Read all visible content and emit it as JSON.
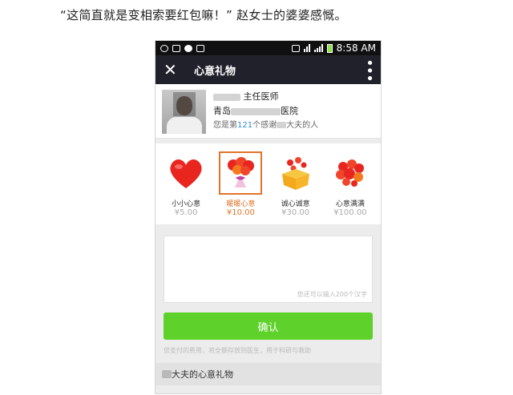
{
  "caption": "“这简直就是变相索要红包嘛！” 赵女士的婆婆感慨。",
  "status_bar": {
    "time": "8:58 AM"
  },
  "titlebar": {
    "title": "心意礼物",
    "close_icon": "close-icon",
    "more_icon": "more-vertical-icon"
  },
  "doctor": {
    "title": "主任医师",
    "hospital_prefix": "青岛",
    "hospital_suffix": "医院",
    "thanks_prefix": "您是第",
    "thanks_count": "121",
    "thanks_middle": "个感谢",
    "thanks_suffix": "大夫的人"
  },
  "gifts": [
    {
      "name": "小小心意",
      "price": "¥5.00",
      "icon": "heart-icon"
    },
    {
      "name": "暖暖心意",
      "price": "¥10.00",
      "icon": "balloons-icon",
      "selected": true
    },
    {
      "name": "诚心诚意",
      "price": "¥30.00",
      "icon": "gift-box-icon"
    },
    {
      "name": "心意满满",
      "price": "¥100.00",
      "icon": "heart-bouquet-icon"
    }
  ],
  "message": {
    "counter": "您还可以输入200个汉字"
  },
  "confirm_label": "确认",
  "note": "您支付的费用，将全额存放到医生，用于科研与救助",
  "section_title": "大夫的心意礼物",
  "colors": {
    "accent": "#e0742b",
    "confirm": "#5ed12b",
    "titlebar": "#21212b"
  }
}
